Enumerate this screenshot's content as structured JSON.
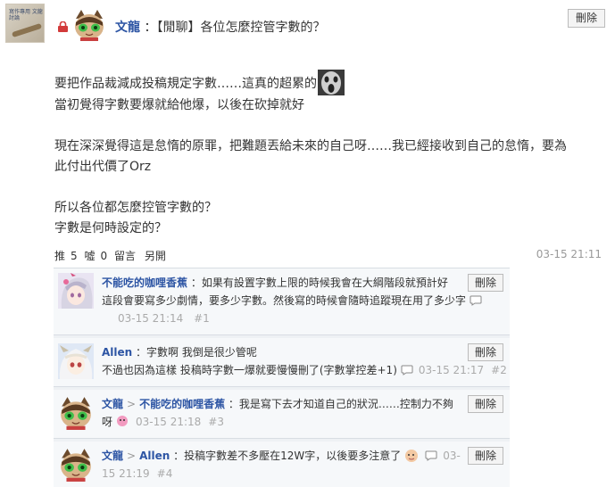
{
  "post": {
    "author": "文龍",
    "title_sep": "：",
    "title": "【閒聊】各位怎麼控管字數的？",
    "delete_label": "刪除",
    "thumb_text": "寫作專用 文龍 討論",
    "body": {
      "line1": "要把作品裁減成投稿規定字數……這真的超累的",
      "line2": "當初覺得字數要爆就給他爆，以後在砍掉就好",
      "line3": "現在深深覺得這是怠惰的原罪，把難題丟給未來的自己呀……我已經接收到自己的怠惰，要為",
      "line4": "此付出代價了Orz",
      "line5": "所以各位都怎麼控管字數的？",
      "line6": "字數是何時設定的？"
    },
    "actions": {
      "push_label": "推",
      "push_count": "5",
      "boo_label": "噓",
      "boo_count": "0",
      "reply_label": "留言",
      "share_label": "另開"
    },
    "time": "03-15 21:11"
  },
  "replies": [
    {
      "author": "不能吃的咖哩香蕉",
      "line1": "：如果有設置字數上限的時候我會在大綱階段就預計好",
      "line2": "這段會要寫多少劇情，要多少字數。然後寫的時候會隨時追蹤現在用了多少字",
      "time": "03-15 21:14",
      "index": "#1",
      "delete_label": "刪除",
      "avatar": "anime-girl-avatar"
    },
    {
      "author": "Allen",
      "line1": "：字數啊 我倒是很少管呢",
      "line2": "不過也因為這樣 投稿時字數一爆就要慢慢刪了(字數掌控差+1)",
      "time": "03-15 21:17",
      "index": "#2",
      "delete_label": "刪除",
      "avatar": "white-hair-avatar"
    },
    {
      "author": "文龍",
      "target": "不能吃的咖哩香蕉",
      "arrow": ">",
      "line1": "：我是寫下去才知道自己的狀況……控制力不夠",
      "line2": "呀",
      "time": "03-15 21:18",
      "index": "#3",
      "delete_label": "刪除",
      "avatar": "cat-avatar"
    },
    {
      "author": "文龍",
      "target": "Allen",
      "arrow": ">",
      "line1": "：投稿字數差不多壓在12W字，以後要多注意了",
      "time_part1": "03-",
      "time_part2": "15 21:19",
      "index": "#4",
      "delete_label": "刪除",
      "avatar": "cat-avatar"
    }
  ],
  "colors": {
    "link": "#2d55a4",
    "muted": "#999999",
    "reply_bg": "#f6f8fa"
  }
}
